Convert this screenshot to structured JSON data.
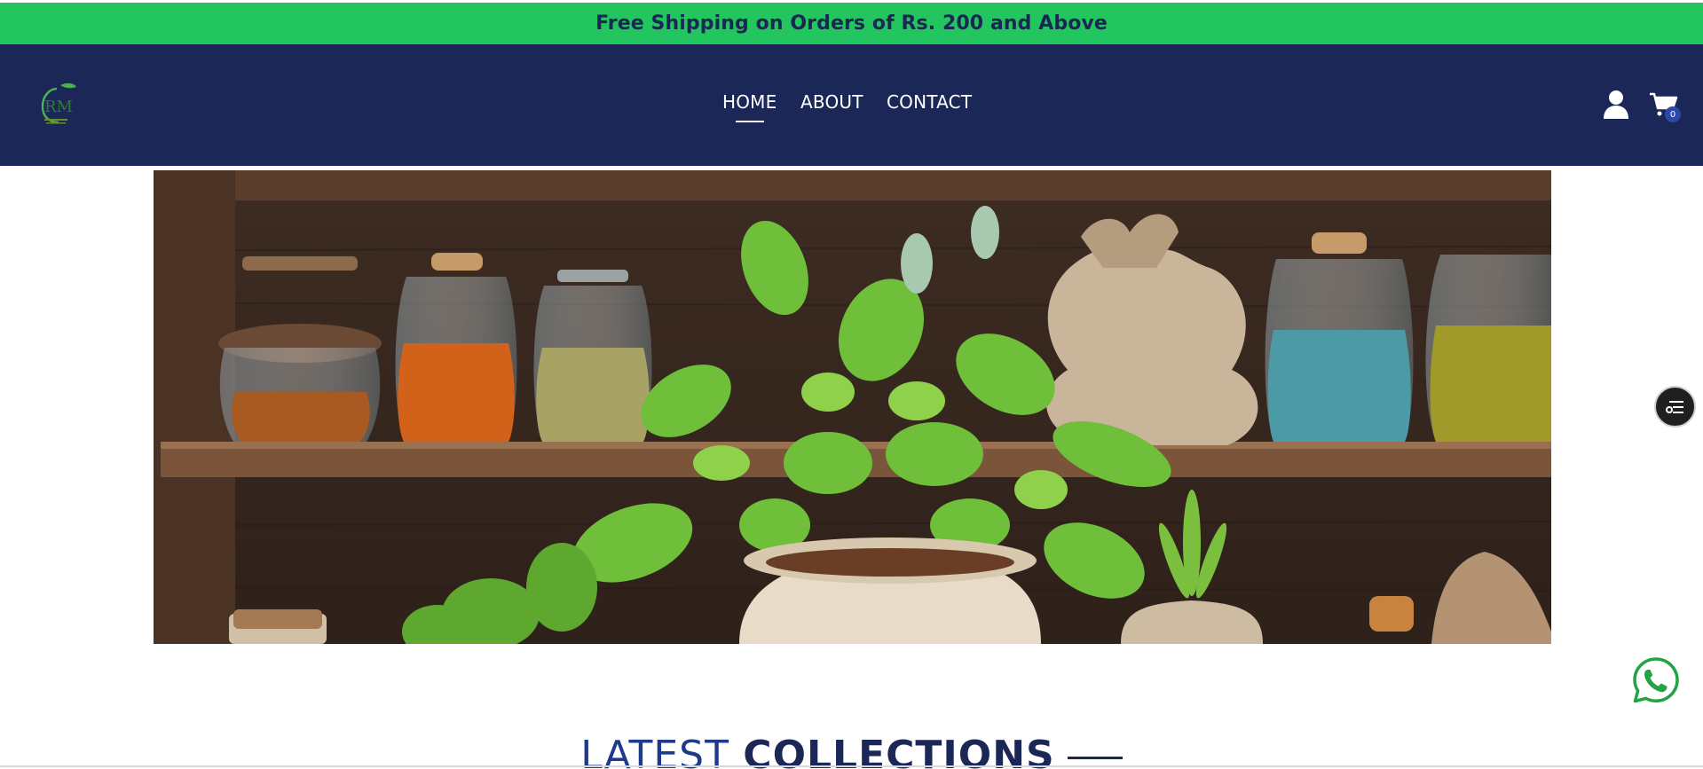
{
  "promo": {
    "text": "Free Shipping on Orders of Rs. 200 and Above"
  },
  "header": {
    "logo_text": "RM",
    "nav": [
      {
        "label": "HOME",
        "active": true
      },
      {
        "label": "ABOUT",
        "active": false
      },
      {
        "label": "CONTACT",
        "active": false
      }
    ],
    "cart_count": "0"
  },
  "section": {
    "title_light": "LATEST",
    "title_bold": "COLLECTIONS"
  },
  "icons": {
    "logo": "leaf-logo-icon",
    "user": "user-icon",
    "cart": "cart-icon",
    "filter": "filter-icon",
    "whatsapp": "whatsapp-icon"
  },
  "colors": {
    "promo_bg": "#22c55e",
    "header_bg": "#1b2757",
    "accent": "#1f3a8a",
    "whatsapp": "#25a244"
  }
}
